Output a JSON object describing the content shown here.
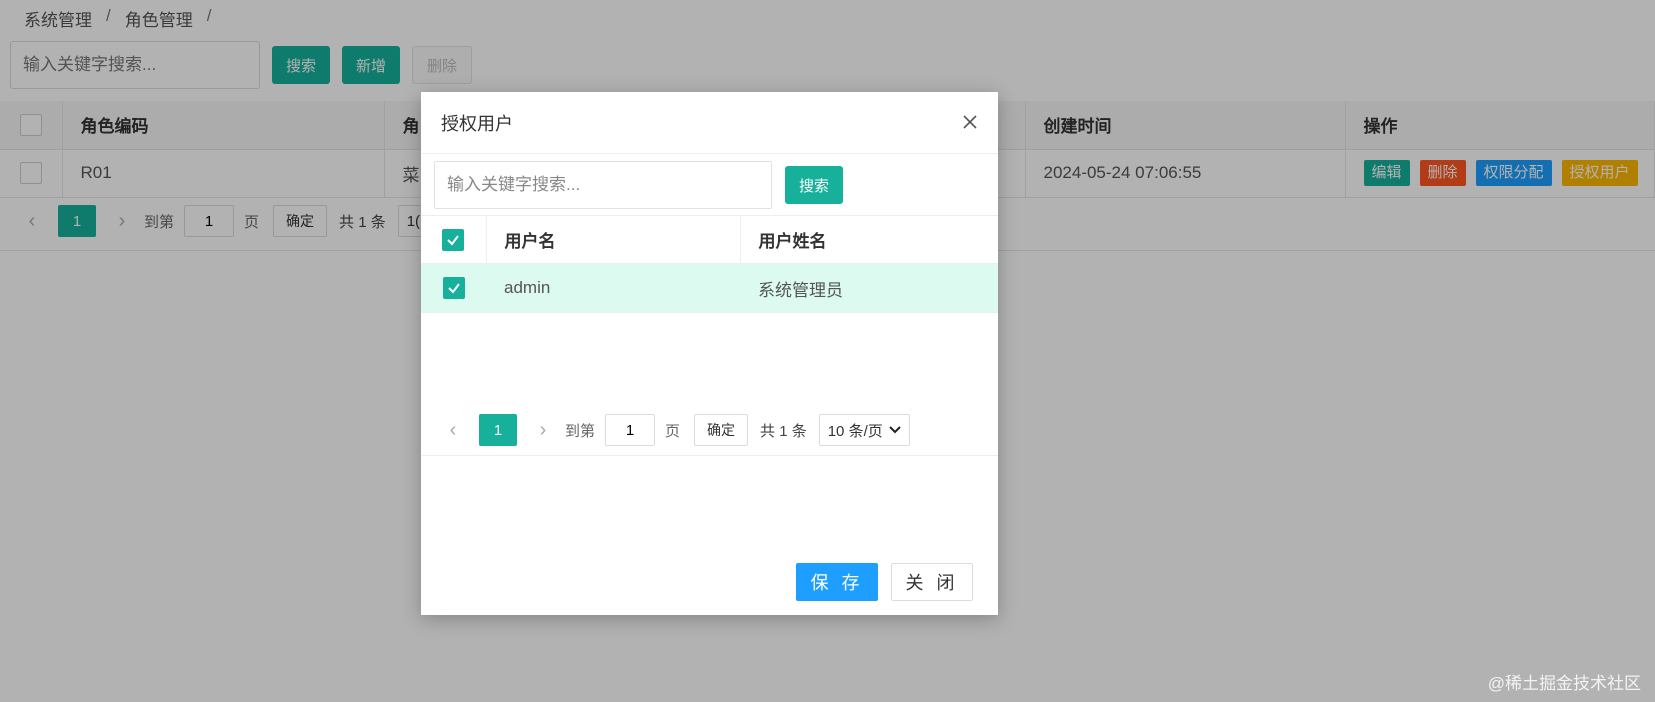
{
  "breadcrumb": {
    "items": [
      "系统管理",
      "角色管理"
    ],
    "separator": "/"
  },
  "toolbar": {
    "search_placeholder": "输入关键字搜索...",
    "search_label": "搜索",
    "add_label": "新增",
    "delete_label": "删除"
  },
  "role_table": {
    "headers": [
      "角色编码",
      "角",
      "创建时间",
      "操作"
    ],
    "rows": [
      {
        "code": "R01",
        "name_partial": "菜",
        "created": "2024-05-24 07:06:55"
      }
    ],
    "actions": {
      "edit": "编辑",
      "delete": "删除",
      "perm": "权限分配",
      "auth_user": "授权用户"
    }
  },
  "role_pager": {
    "current_page": "1",
    "goto_label": "到第",
    "page_input": "1",
    "page_unit": "页",
    "confirm_label": "确定",
    "total": "共 1 条",
    "page_size_partial": "1("
  },
  "modal": {
    "title": "授权用户",
    "search_placeholder": "输入关键字搜索...",
    "search_label": "搜索",
    "table": {
      "headers": [
        "用户名",
        "用户姓名"
      ],
      "rows": [
        {
          "username": "admin",
          "fullname": "系统管理员",
          "checked": true
        }
      ]
    },
    "pager": {
      "current_page": "1",
      "goto_label": "到第",
      "page_input": "1",
      "page_unit": "页",
      "confirm_label": "确定",
      "total": "共 1 条",
      "page_size": "10 条/页"
    },
    "save_label": "保 存",
    "close_label": "关 闭"
  },
  "watermark": "@稀土掘金技术社区",
  "colors": {
    "teal": "#16b09b",
    "blue": "#1e9fff",
    "red": "#ff5722",
    "orange": "#ffb800",
    "row_selected": "#dcfaf0"
  }
}
